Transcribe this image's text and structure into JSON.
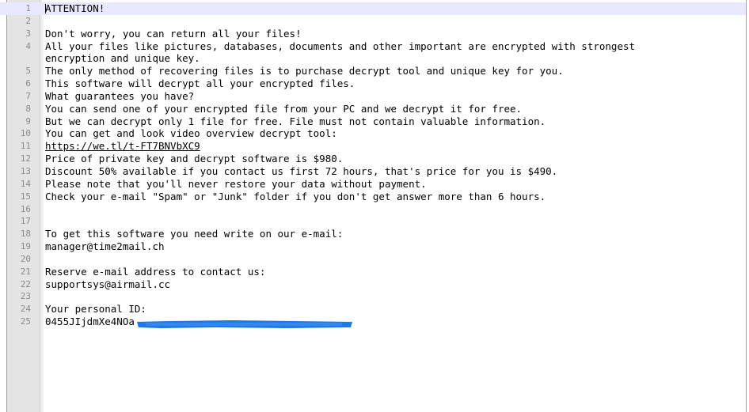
{
  "editor": {
    "lines": [
      {
        "no": "1",
        "text": "ATTENTION!"
      },
      {
        "no": "2",
        "text": ""
      },
      {
        "no": "3",
        "text": "Don't worry, you can return all your files!"
      },
      {
        "no": "4",
        "text": "All your files like pictures, databases, documents and other important are encrypted with strongest"
      },
      {
        "no": "",
        "text": "encryption and unique key."
      },
      {
        "no": "5",
        "text": "The only method of recovering files is to purchase decrypt tool and unique key for you."
      },
      {
        "no": "6",
        "text": "This software will decrypt all your encrypted files."
      },
      {
        "no": "7",
        "text": "What guarantees you have?"
      },
      {
        "no": "8",
        "text": "You can send one of your encrypted file from your PC and we decrypt it for free."
      },
      {
        "no": "9",
        "text": "But we can decrypt only 1 file for free. File must not contain valuable information."
      },
      {
        "no": "10",
        "text": "You can get and look video overview decrypt tool:"
      },
      {
        "no": "11",
        "text": "https://we.tl/t-FT7BNVbXC9"
      },
      {
        "no": "12",
        "text": "Price of private key and decrypt software is $980."
      },
      {
        "no": "13",
        "text": "Discount 50% available if you contact us first 72 hours, that's price for you is $490."
      },
      {
        "no": "14",
        "text": "Please note that you'll never restore your data without payment."
      },
      {
        "no": "15",
        "text": "Check your e-mail \"Spam\" or \"Junk\" folder if you don't get answer more than 6 hours."
      },
      {
        "no": "16",
        "text": ""
      },
      {
        "no": "17",
        "text": ""
      },
      {
        "no": "18",
        "text": "To get this software you need write on our e-mail:"
      },
      {
        "no": "19",
        "text": "manager@time2mail.ch"
      },
      {
        "no": "20",
        "text": ""
      },
      {
        "no": "21",
        "text": "Reserve e-mail address to contact us:"
      },
      {
        "no": "22",
        "text": "supportsys@airmail.cc"
      },
      {
        "no": "23",
        "text": ""
      },
      {
        "no": "24",
        "text": "Your personal ID:"
      },
      {
        "no": "25",
        "text": "0455JIjdmXe4NOa"
      }
    ],
    "colors": {
      "gutter": "#e4e4e4",
      "current_line": "#e8e8ff",
      "line_number": "#8a8a8a",
      "redaction": "#1e78e6"
    }
  }
}
